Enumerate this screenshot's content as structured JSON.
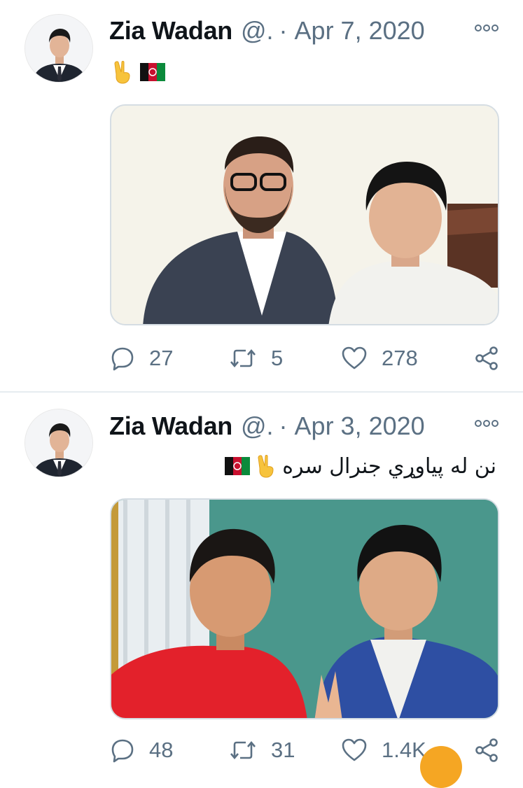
{
  "tweets": [
    {
      "author": "Zia Wadan",
      "handle": "@.",
      "separator": "·",
      "date": "Apr 7, 2020",
      "text": "",
      "emoji": [
        "victory-hand-icon",
        "afghanistan-flag-icon"
      ],
      "media": {
        "type": "photo",
        "description": "two men posing indoors"
      },
      "actions": {
        "replies": "27",
        "retweets": "5",
        "likes": "278"
      }
    },
    {
      "author": "Zia Wadan",
      "handle": "@.",
      "separator": "·",
      "date": "Apr 3, 2020",
      "text": "نن له پیاوړي جنرال سره",
      "emoji": [
        "victory-hand-icon",
        "afghanistan-flag-icon"
      ],
      "media": {
        "type": "photo",
        "description": "two men posing outdoors"
      },
      "actions": {
        "replies": "48",
        "retweets": "31",
        "likes": "1.4K"
      }
    }
  ],
  "colors": {
    "text_primary": "#0f1419",
    "text_secondary": "#5b7083",
    "divider": "#e6ecf0",
    "media_border": "#d5dde3"
  }
}
